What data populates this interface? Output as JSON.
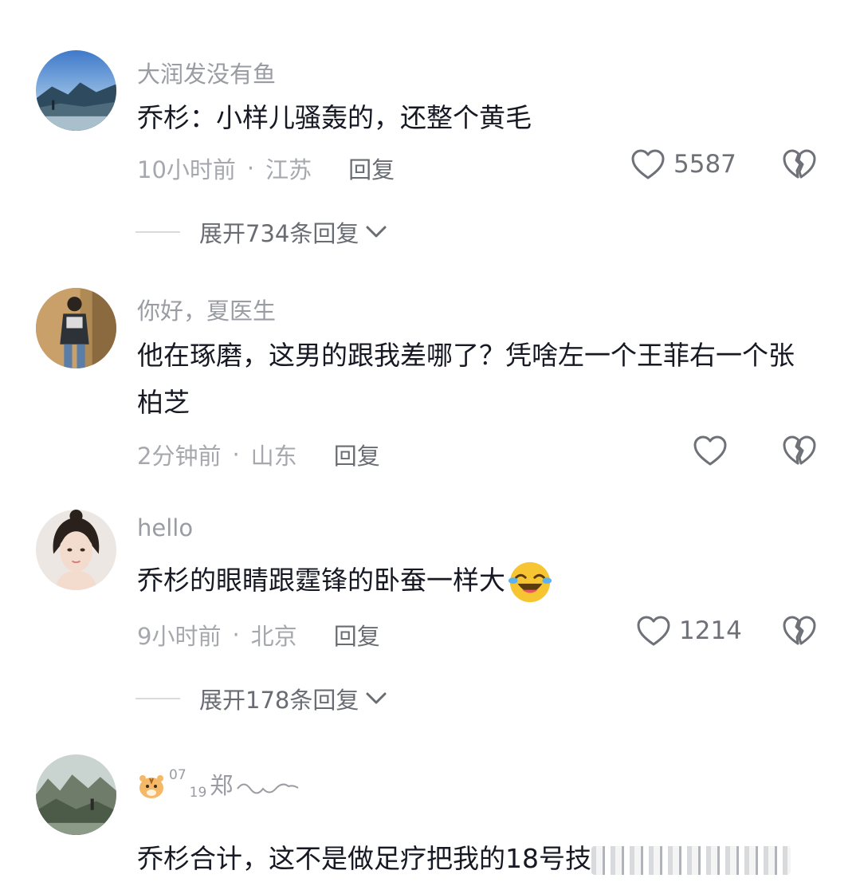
{
  "comments": [
    {
      "username": "大润发没有鱼",
      "text": "乔杉：小样儿骚轰的，还整个黄毛",
      "time": "10小时前",
      "location": "江苏",
      "reply_label": "回复",
      "likes": "5587",
      "expand": "展开734条回复"
    },
    {
      "username": "你好，夏医生",
      "text": "他在琢磨，这男的跟我差哪了？凭啥左一个王菲右一个张柏芝",
      "time": "2分钟前",
      "location": "山东",
      "reply_label": "回复",
      "likes": ""
    },
    {
      "username": "hello",
      "text": "乔杉的眼睛跟霆锋的卧蚕一样大",
      "time": "9小时前",
      "location": "北京",
      "reply_label": "回复",
      "likes": "1214",
      "expand": "展开178条回复"
    },
    {
      "username_parts": {
        "sup": "07",
        "sub": "19",
        "name": "郑"
      },
      "text": "乔杉合计，这不是做足疗把我的18号技"
    }
  ],
  "icons": {
    "like": "heart-outline-icon",
    "dislike": "broken-heart-icon",
    "expand": "chevron-down-icon",
    "emoji": "laughing-tears-emoji",
    "username_emoji": "tiger-face-emoji"
  }
}
